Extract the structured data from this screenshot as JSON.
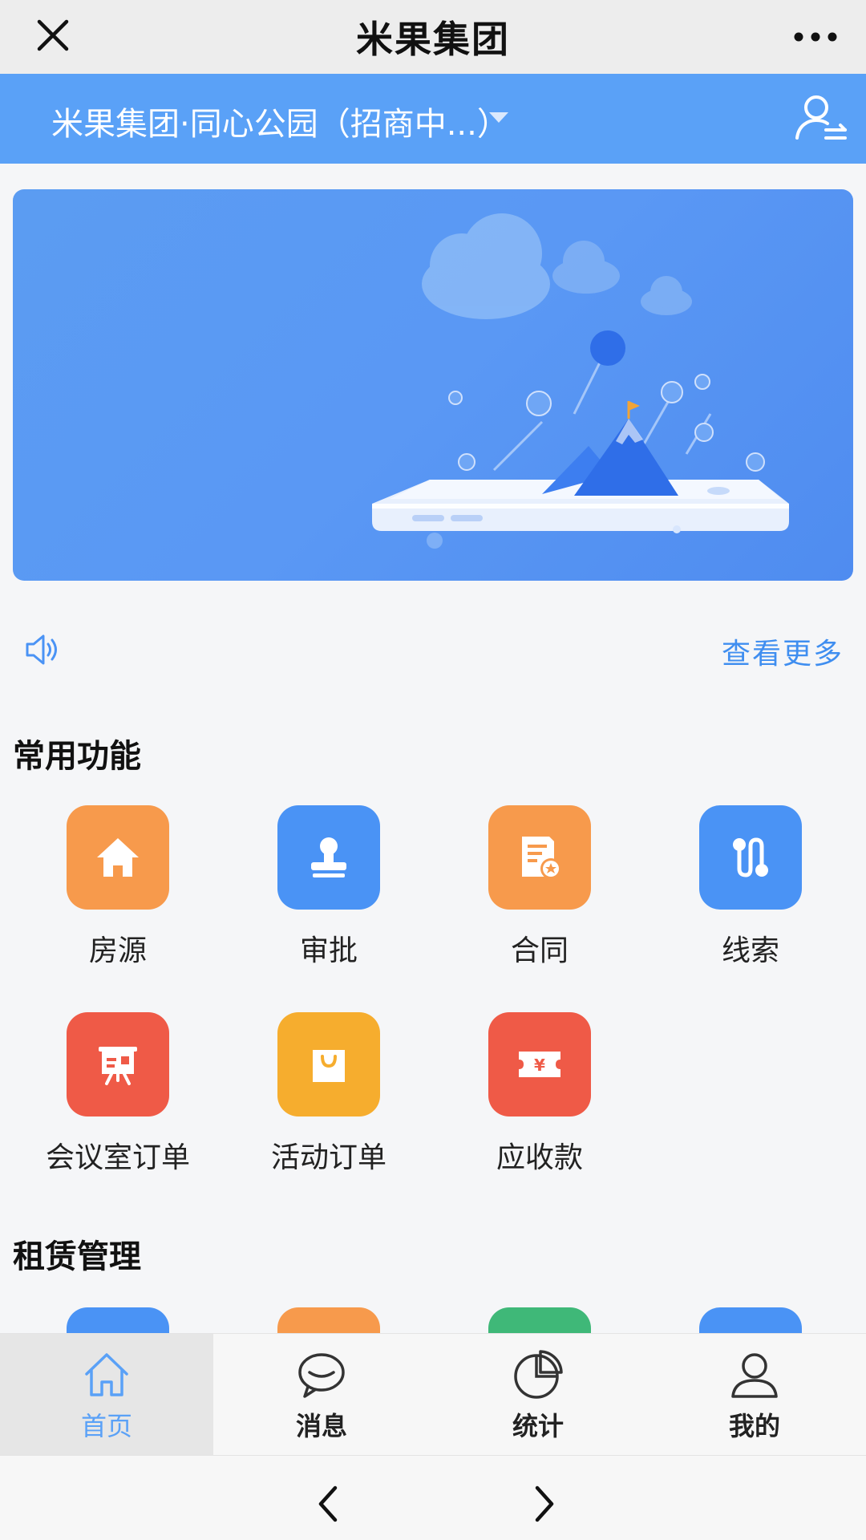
{
  "titlebar": {
    "title": "米果集团"
  },
  "org": {
    "name": "米果集团·同心公园（招商中...）"
  },
  "notice": {
    "more_label": "查看更多"
  },
  "sections": {
    "common": {
      "title": "常用功能",
      "items": [
        {
          "label": "房源",
          "icon": "house-icon",
          "color": "#f79a4c"
        },
        {
          "label": "审批",
          "icon": "stamp-icon",
          "color": "#4a93f5"
        },
        {
          "label": "合同",
          "icon": "contract-icon",
          "color": "#f79a4c"
        },
        {
          "label": "线索",
          "icon": "route-icon",
          "color": "#4a93f5"
        },
        {
          "label": "会议室订单",
          "icon": "presentation-icon",
          "color": "#ef5a47"
        },
        {
          "label": "活动订单",
          "icon": "shopping-bag-icon",
          "color": "#f6ad2e"
        },
        {
          "label": "应收款",
          "icon": "ticket-yen-icon",
          "color": "#ef5a47"
        }
      ]
    },
    "lease": {
      "title": "租赁管理"
    }
  },
  "tabs": [
    {
      "label": "首页",
      "icon": "home-icon",
      "active": true
    },
    {
      "label": "消息",
      "icon": "chat-icon",
      "active": false
    },
    {
      "label": "统计",
      "icon": "pie-chart-icon",
      "active": false
    },
    {
      "label": "我的",
      "icon": "user-icon",
      "active": false
    }
  ],
  "colors": {
    "accent": "#5aa1f7",
    "link": "#3f8ef0"
  }
}
